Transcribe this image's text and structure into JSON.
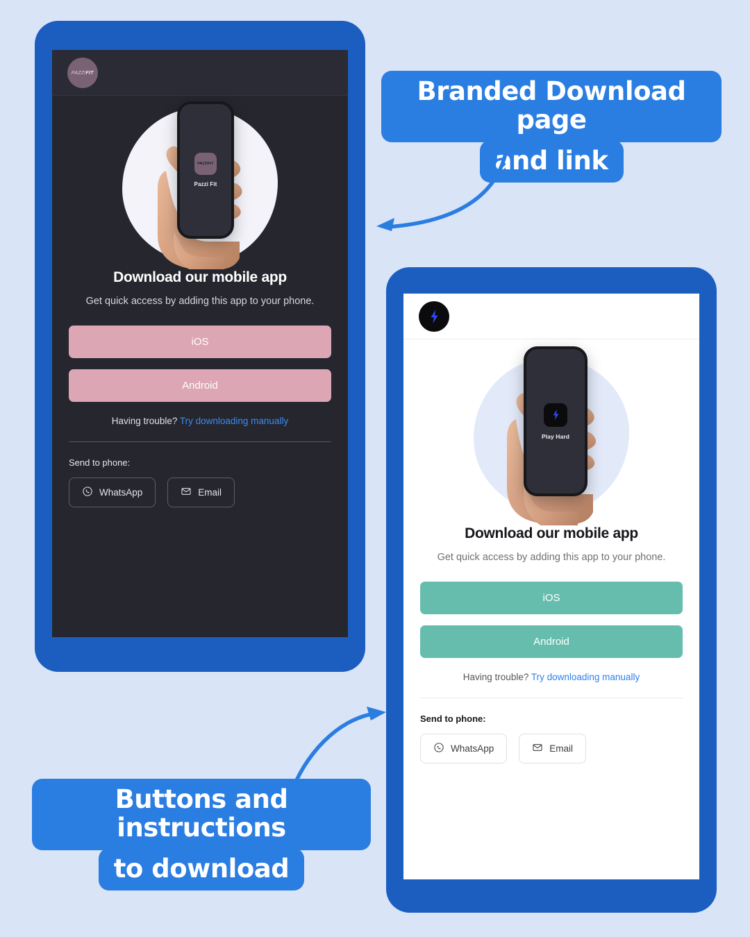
{
  "background_color": "#d9e4f7",
  "frame_color": "#1b5ec0",
  "callouts": {
    "top": {
      "line1": "Branded Download page",
      "line2": "and link"
    },
    "bottom": {
      "line1": "Buttons and instructions",
      "line2": "to download"
    }
  },
  "dark_mockup": {
    "theme": "dark",
    "screen_bg": "#25262e",
    "accent_color": "#dca6b4",
    "brand": {
      "wordmark_bold": "FIT",
      "wordmark_thin": "PAZZI",
      "badge_color": "#7a6275"
    },
    "phone_preview": {
      "app_name": "Pazzi Fit",
      "tile_color": "#7a6275"
    },
    "title": "Download our mobile app",
    "subtitle": "Get quick access by adding this app to your phone.",
    "buttons": {
      "ios": "iOS",
      "android": "Android"
    },
    "trouble": {
      "text": "Having trouble?",
      "link": "Try downloading manually"
    },
    "send_label": "Send to phone:",
    "share": {
      "whatsapp": "WhatsApp",
      "email": "Email"
    }
  },
  "light_mockup": {
    "theme": "light",
    "screen_bg": "#ffffff",
    "accent_color": "#66bdae",
    "brand": {
      "badge_color": "#0b0b0d",
      "icon": "lightning-bolt-icon",
      "icon_color": "#2d4bf5"
    },
    "phone_preview": {
      "app_name": "Play Hard",
      "tile_color": "#0b0b0d"
    },
    "title": "Download our mobile app",
    "subtitle": "Get quick access by adding this app to your phone.",
    "buttons": {
      "ios": "iOS",
      "android": "Android"
    },
    "trouble": {
      "text": "Having trouble?",
      "link": "Try downloading manually"
    },
    "send_label": "Send to phone:",
    "share": {
      "whatsapp": "WhatsApp",
      "email": "Email"
    }
  }
}
